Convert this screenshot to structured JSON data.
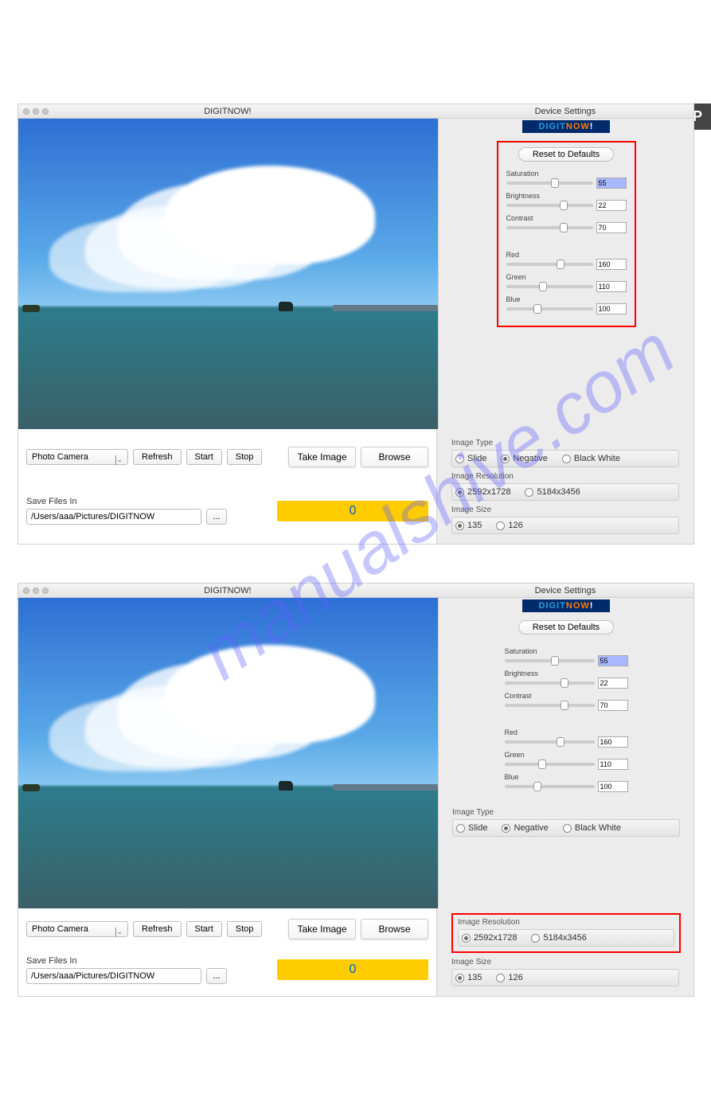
{
  "badge": "SP",
  "watermark": "manualshive.com",
  "window": {
    "left_title": "DIGITNOW!",
    "right_title": "Device Settings",
    "brand_part1": "DIGIT",
    "brand_part2": "NOW",
    "brand_part3": "!",
    "reset": "Reset to Defaults",
    "sliders": {
      "saturation": {
        "label": "Saturation",
        "value": "55",
        "pos": 52
      },
      "brightness": {
        "label": "Brightness",
        "value": "22",
        "pos": 62
      },
      "contrast": {
        "label": "Contrast",
        "value": "70",
        "pos": 62
      },
      "red": {
        "label": "Red",
        "value": "160",
        "pos": 58
      },
      "green": {
        "label": "Green",
        "value": "110",
        "pos": 38
      },
      "blue": {
        "label": "Blue",
        "value": "100",
        "pos": 32
      }
    },
    "image_type": {
      "label": "Image Type",
      "options": [
        "Slide",
        "Negative",
        "Black White"
      ],
      "selected": "Negative"
    },
    "image_resolution": {
      "label": "Image Resolution",
      "options": [
        "2592x1728",
        "5184x3456"
      ],
      "selected": "2592x1728"
    },
    "image_size": {
      "label": "Image Size",
      "options": [
        "135",
        "126"
      ],
      "selected": "135"
    },
    "controls": {
      "dropdown": "Photo Camera",
      "refresh": "Refresh",
      "start": "Start",
      "stop": "Stop",
      "take_image": "Take Image",
      "browse": "Browse",
      "save_files_in": "Save Files In",
      "path": "/Users/aaa/Pictures/DIGITNOW",
      "dots": "...",
      "counter": "0"
    }
  }
}
